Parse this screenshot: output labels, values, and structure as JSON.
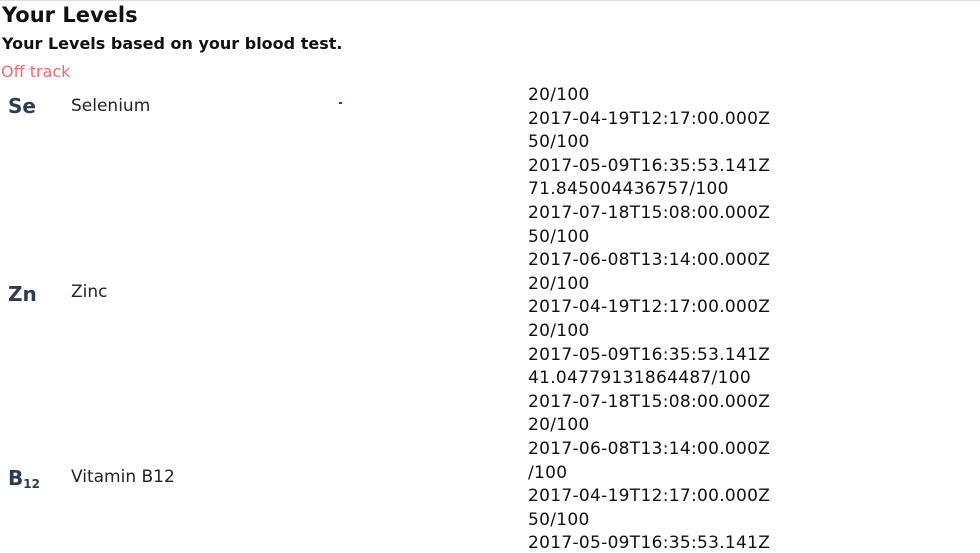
{
  "header": {
    "title": "Your Levels",
    "subtitle": "Your Levels based on your blood test.",
    "status": "Off track"
  },
  "colors": {
    "status": "#f36b6b",
    "symbol": "#2e3b55"
  },
  "nutrients": [
    {
      "symbol": "Se",
      "symbol_sub": "",
      "name": "Selenium",
      "readings": [
        {
          "score": "20/100",
          "date": "2017-04-19T12:17:00.000Z"
        },
        {
          "score": "50/100",
          "date": "2017-05-09T16:35:53.141Z"
        },
        {
          "score": "71.845004436757/100",
          "date": "2017-07-18T15:08:00.000Z"
        },
        {
          "score": "50/100",
          "date": "2017-06-08T13:14:00.000Z"
        }
      ]
    },
    {
      "symbol": "Zn",
      "symbol_sub": "",
      "name": "Zinc",
      "readings": [
        {
          "score": "20/100",
          "date": "2017-04-19T12:17:00.000Z"
        },
        {
          "score": "20/100",
          "date": "2017-05-09T16:35:53.141Z"
        },
        {
          "score": "41.04779131864487/100",
          "date": "2017-07-18T15:08:00.000Z"
        },
        {
          "score": "20/100",
          "date": "2017-06-08T13:14:00.000Z"
        }
      ]
    },
    {
      "symbol": "B",
      "symbol_sub": "12",
      "name": "Vitamin B12",
      "readings": [
        {
          "score": "/100",
          "date": "2017-04-19T12:17:00.000Z"
        },
        {
          "score": "50/100",
          "date": "2017-05-09T16:35:53.141Z"
        }
      ]
    }
  ]
}
